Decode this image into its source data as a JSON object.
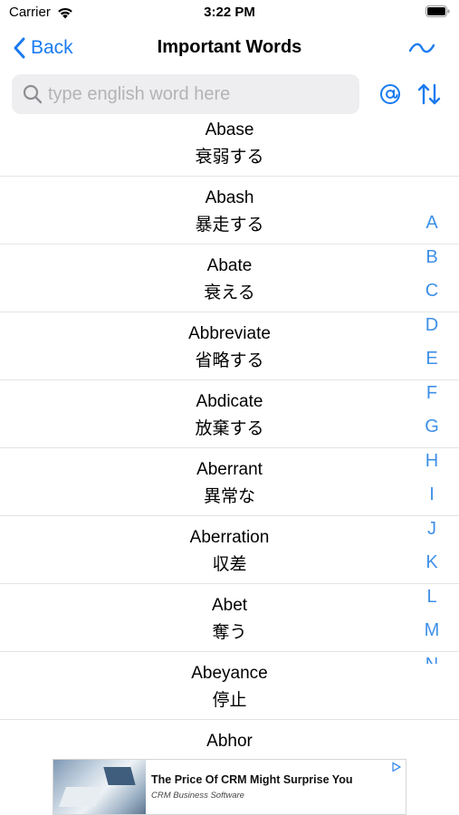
{
  "status_bar": {
    "carrier": "Carrier",
    "time": "3:22 PM"
  },
  "nav": {
    "back_label": "Back",
    "title": "Important Words",
    "right_icon": "tilde-icon"
  },
  "search": {
    "placeholder": "type english word here",
    "value": "",
    "icons": [
      "search-icon",
      "at-sign-icon",
      "sort-arrows-icon"
    ]
  },
  "words": [
    {
      "en": "Abase",
      "jp": "衰弱する"
    },
    {
      "en": "Abash",
      "jp": "暴走する"
    },
    {
      "en": "Abate",
      "jp": "衰える"
    },
    {
      "en": "Abbreviate",
      "jp": "省略する"
    },
    {
      "en": "Abdicate",
      "jp": "放棄する"
    },
    {
      "en": "Aberrant",
      "jp": "異常な"
    },
    {
      "en": "Aberration",
      "jp": "収差"
    },
    {
      "en": "Abet",
      "jp": "奪う"
    },
    {
      "en": "Abeyance",
      "jp": "停止"
    },
    {
      "en": "Abhor",
      "jp": ""
    }
  ],
  "index_letters": [
    "A",
    "B",
    "C",
    "D",
    "E",
    "F",
    "G",
    "H",
    "I",
    "J",
    "K",
    "L",
    "M",
    "N"
  ],
  "ad": {
    "title": "The Price Of CRM Might Surprise You",
    "subtitle": "CRM Business Software"
  },
  "colors": {
    "accent": "#1a7bf0",
    "index": "#3e90e8",
    "search_bg": "#eeeef0",
    "separator": "#e4e4e6"
  }
}
